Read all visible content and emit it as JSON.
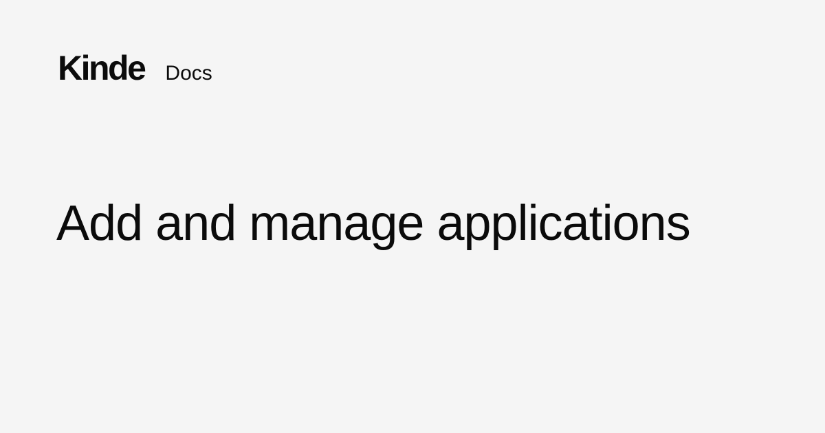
{
  "brand": {
    "logo_text": "Kinde",
    "section_label": "Docs"
  },
  "page": {
    "title": "Add and manage applications"
  },
  "colors": {
    "background": "#f5f5f5",
    "text": "#0b0b0b"
  }
}
